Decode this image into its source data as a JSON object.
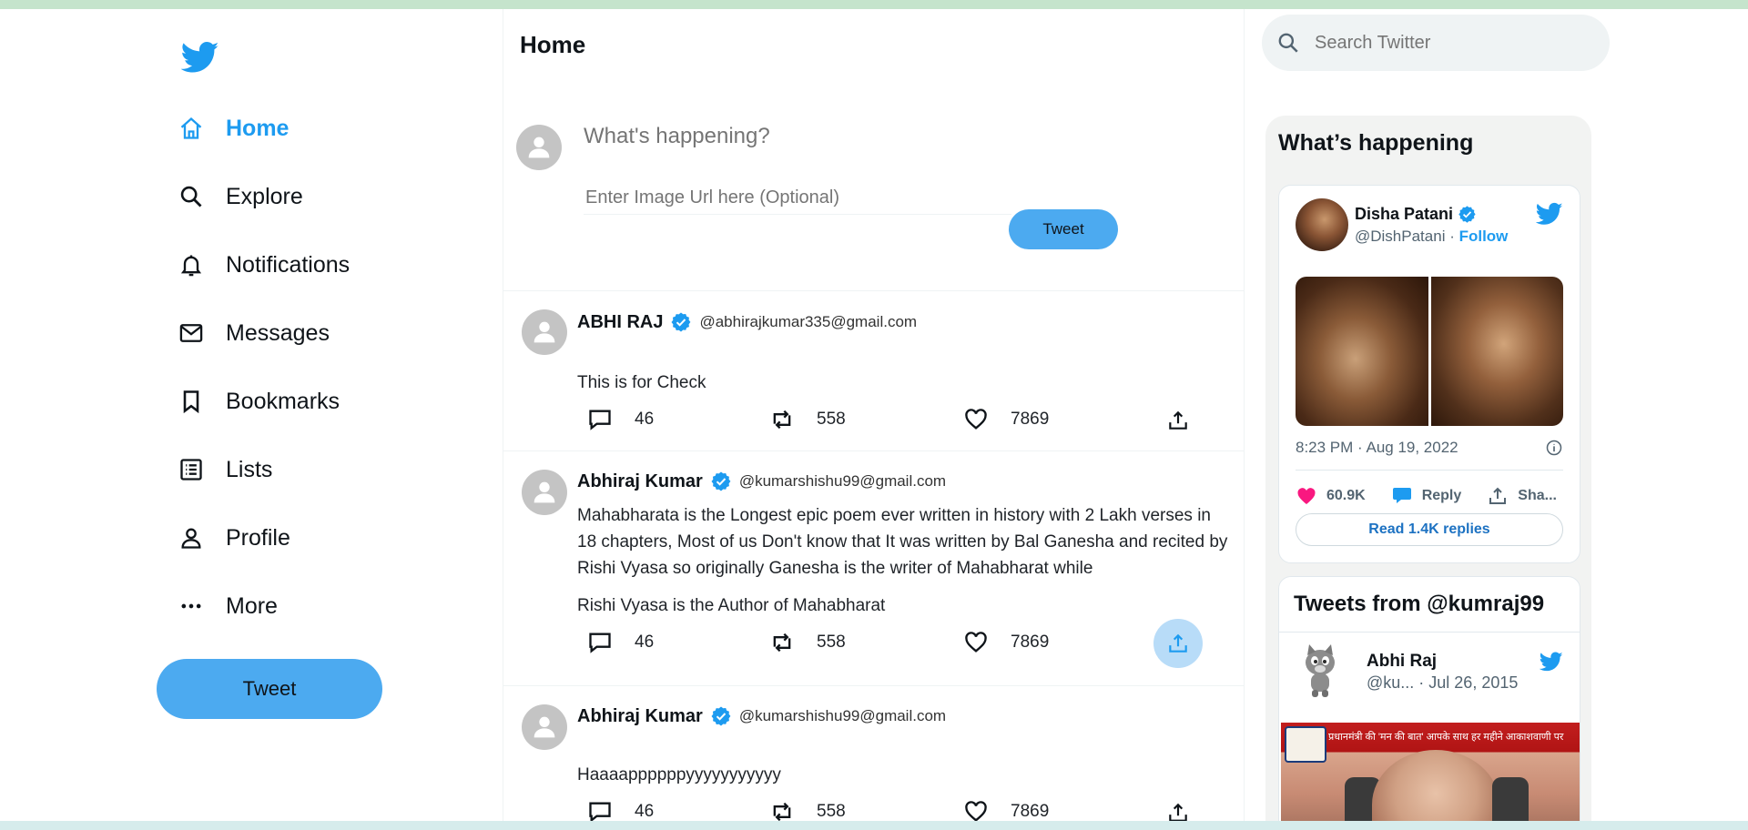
{
  "colors": {
    "accent": "#1d9bf0",
    "tweet_button": "#4caaf0",
    "like_pink": "#f91880"
  },
  "nav": {
    "items": [
      {
        "label": "Home",
        "icon": "home-icon",
        "active": true
      },
      {
        "label": "Explore",
        "icon": "search-icon"
      },
      {
        "label": "Notifications",
        "icon": "bell-icon"
      },
      {
        "label": "Messages",
        "icon": "mail-icon"
      },
      {
        "label": "Bookmarks",
        "icon": "bookmark-icon"
      },
      {
        "label": "Lists",
        "icon": "list-icon"
      },
      {
        "label": "Profile",
        "icon": "person-icon"
      },
      {
        "label": "More",
        "icon": "more-icon"
      }
    ],
    "tweet_button": "Tweet"
  },
  "feed": {
    "title": "Home",
    "compose": {
      "placeholder": "What's happening?",
      "image_placeholder": "Enter Image Url here (Optional)",
      "tweet_button": "Tweet"
    },
    "posts": [
      {
        "name": "ABHI RAJ",
        "handle": "@abhirajkumar335@gmail.com",
        "text": "This is for Check",
        "text2": "",
        "replies": "46",
        "retweets": "558",
        "likes": "7869"
      },
      {
        "name": "Abhiraj Kumar",
        "handle": "@kumarshishu99@gmail.com",
        "text": "Mahabharata is the Longest epic poem ever written in history with 2 Lakh verses in 18 chapters, Most of us Don't know that It was written by Bal Ganesha and recited by Rishi Vyasa so originally Ganesha is the writer of Mahabharat while",
        "text2": "Rishi Vyasa is the Author of Mahabharat",
        "replies": "46",
        "retweets": "558",
        "likes": "7869"
      },
      {
        "name": "Abhiraj Kumar",
        "handle": "@kumarshishu99@gmail.com",
        "text": "Haaaappppppyyyyyyyyyyy",
        "text2": "",
        "replies": "46",
        "retweets": "558",
        "likes": "7869"
      }
    ]
  },
  "right": {
    "search_placeholder": "Search Twitter",
    "trends_title": "What’s happening",
    "embed": {
      "name": "Disha Patani",
      "handle": "@DishPatani",
      "separator": " · ",
      "follow": "Follow",
      "time": "8:23 PM · Aug 19, 2022",
      "likes": "60.9K",
      "reply": "Reply",
      "share": "Sha...",
      "read_replies": "Read 1.4K replies"
    },
    "timeline": {
      "title": "Tweets from @kumraj99",
      "name": "Abhi Raj",
      "sub": "@ku... · Jul 26, 2015",
      "banner": "प्रधानमंत्री की 'मन की बात' आपके साथ हर महीने आकाशवाणी पर"
    }
  }
}
